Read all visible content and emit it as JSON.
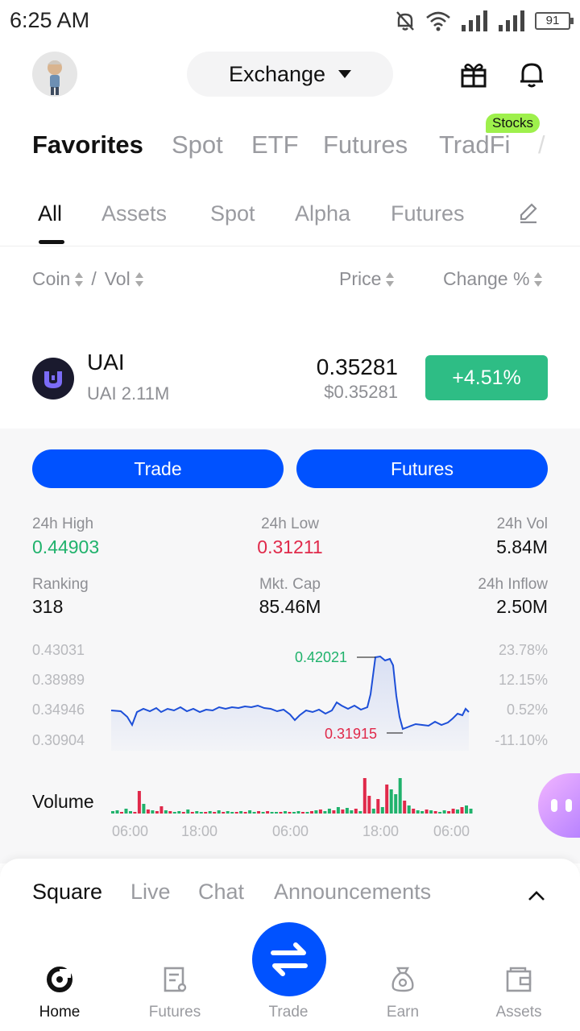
{
  "status_bar": {
    "time": "6:25 AM",
    "battery": "91"
  },
  "header": {
    "exchange_label": "Exchange"
  },
  "market_tabs": [
    {
      "label": "Favorites"
    },
    {
      "label": "Spot"
    },
    {
      "label": "ETF"
    },
    {
      "label": "Futures"
    },
    {
      "label": "TradFi"
    }
  ],
  "stocks_badge": "Stocks",
  "sub_tabs": [
    {
      "label": "All"
    },
    {
      "label": "Assets"
    },
    {
      "label": "Spot"
    },
    {
      "label": "Alpha"
    },
    {
      "label": "Futures"
    }
  ],
  "columns": {
    "coin": "Coin",
    "separator": "/",
    "vol": "Vol",
    "price": "Price",
    "change": "Change %"
  },
  "coin": {
    "symbol": "UAI",
    "volume": "UAI 2.11M",
    "price": "0.35281",
    "price_usd": "$0.35281",
    "change": "+4.51%"
  },
  "actions": {
    "trade": "Trade",
    "futures": "Futures"
  },
  "stats": {
    "high_label": "24h High",
    "high_value": "0.44903",
    "low_label": "24h Low",
    "low_value": "0.31211",
    "vol_label": "24h Vol",
    "vol_value": "5.84M",
    "rank_label": "Ranking",
    "rank_value": "318",
    "cap_label": "Mkt. Cap",
    "cap_value": "85.46M",
    "inflow_label": "24h Inflow",
    "inflow_value": "2.50M"
  },
  "chart": {
    "price_ticks": [
      "0.43031",
      "0.38989",
      "0.34946",
      "0.30904"
    ],
    "pct_ticks": [
      "23.78%",
      "12.15%",
      "0.52%",
      "-11.10%"
    ],
    "high_marker": "0.42021",
    "low_marker": "0.31915",
    "volume_label": "Volume",
    "time_ticks": [
      "06:00",
      "18:00",
      "06:00",
      "18:00",
      "06:00"
    ],
    "line_color": "#1d4fd8",
    "up_color": "#20b26c",
    "down_color": "#e0294a"
  },
  "feed_tabs": [
    {
      "label": "Square"
    },
    {
      "label": "Live"
    },
    {
      "label": "Chat"
    },
    {
      "label": "Announcements"
    }
  ],
  "bottom_nav": [
    {
      "label": "Home",
      "icon": "home-icon"
    },
    {
      "label": "Futures",
      "icon": "futures-icon"
    },
    {
      "label": "Trade",
      "icon": "trade-icon"
    },
    {
      "label": "Earn",
      "icon": "earn-icon"
    },
    {
      "label": "Assets",
      "icon": "wallet-icon"
    }
  ]
}
